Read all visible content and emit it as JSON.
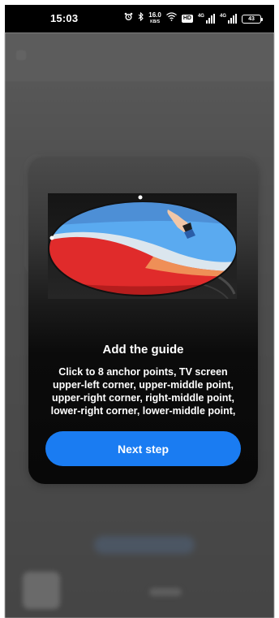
{
  "status_bar": {
    "time": "15:03",
    "net_speed": "16.0",
    "net_unit": "KB/S",
    "hd_label": "HD",
    "sim1_label": "4G",
    "sim2_label": "4G",
    "battery": "43",
    "icons": [
      "alarm-icon",
      "bluetooth-icon",
      "wifi-icon",
      "signal-icon",
      "battery-icon"
    ]
  },
  "dialog": {
    "title": "Add the guide",
    "body": "Click to 8 anchor points, TV screen upper-left corner, upper-middle point, upper-right corner, right-middle point, lower-right corner, lower-middle point,",
    "next_button_label": "Next step"
  },
  "colors": {
    "accent": "#1a7cf2",
    "dialog_bg": "#0b0b0b",
    "overlay": "#4a4a4a"
  }
}
